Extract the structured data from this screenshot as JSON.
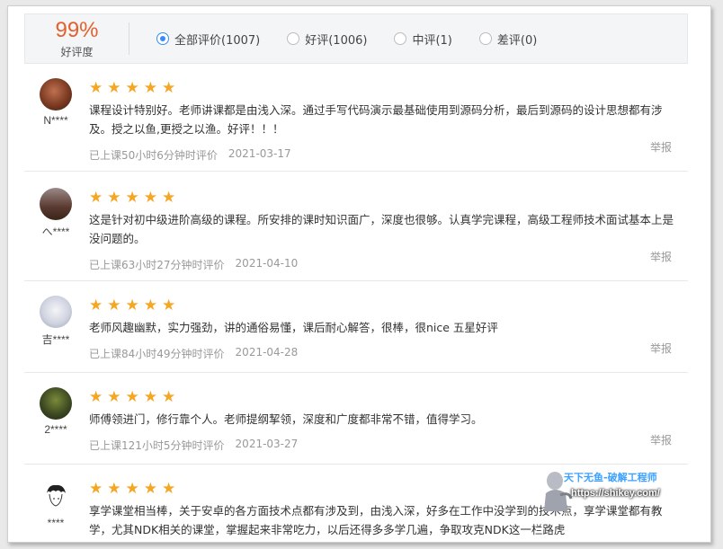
{
  "summary": {
    "rating_percent": "99%",
    "rating_label": "好评度",
    "filters": [
      {
        "label": "全部评价(1007)",
        "checked": true
      },
      {
        "label": "好评(1006)",
        "checked": false
      },
      {
        "label": "中评(1)",
        "checked": false
      },
      {
        "label": "差评(0)",
        "checked": false
      }
    ]
  },
  "reviews": [
    {
      "user": "N****",
      "stars": 5,
      "text": "课程设计特别好。老师讲课都是由浅入深。通过手写代码演示最基础使用到源码分析，最后到源码的设计思想都有涉及。授之以鱼,更授之以渔。好评！！！",
      "study": "已上课50小时6分钟时评价",
      "date": "2021-03-17",
      "report": "举报",
      "avatar_color": "#7a3a22"
    },
    {
      "user": "へ****",
      "stars": 5,
      "text": "这是针对初中级进阶高级的课程。所安排的课时知识面广，深度也很够。认真学完课程，高级工程师技术面试基本上是没问题的。",
      "study": "已上课63小时27分钟时评价",
      "date": "2021-04-10",
      "report": "举报",
      "avatar_color": "#6b4a3a"
    },
    {
      "user": "吉****",
      "stars": 5,
      "text": "老师风趣幽默，实力强劲，讲的通俗易懂，课后耐心解答，很棒，很nice 五星好评",
      "study": "已上课84小时49分钟时评价",
      "date": "2021-04-28",
      "report": "举报",
      "avatar_color": "#d9dde6"
    },
    {
      "user": "2****",
      "stars": 5,
      "text": "师傅领进门，修行靠个人。老师提纲挈领，深度和广度都非常不错，值得学习。",
      "study": "已上课121小时5分钟时评价",
      "date": "2021-03-27",
      "report": "举报",
      "avatar_color": "#3e4a22"
    },
    {
      "user": "****",
      "stars": 5,
      "text": "享学课堂相当棒，关于安卓的各方面技术点都有涉及到，由浅入深，好多在工作中没学到的技术点，享学课堂都有教学，尤其NDK相关的课堂，掌握起来非常吃力，以后还得多多学几遍，争取攻克NDK这一栏路虎",
      "study": "",
      "date": "",
      "report": "",
      "avatar_color": "#ffffff"
    }
  ],
  "watermark": {
    "title": "天下无鱼-破解工程师",
    "url": "https://shikey.com/"
  },
  "colors": {
    "accent": "#3b8cf0",
    "rating": "#e4602d",
    "star": "#f5a623"
  }
}
